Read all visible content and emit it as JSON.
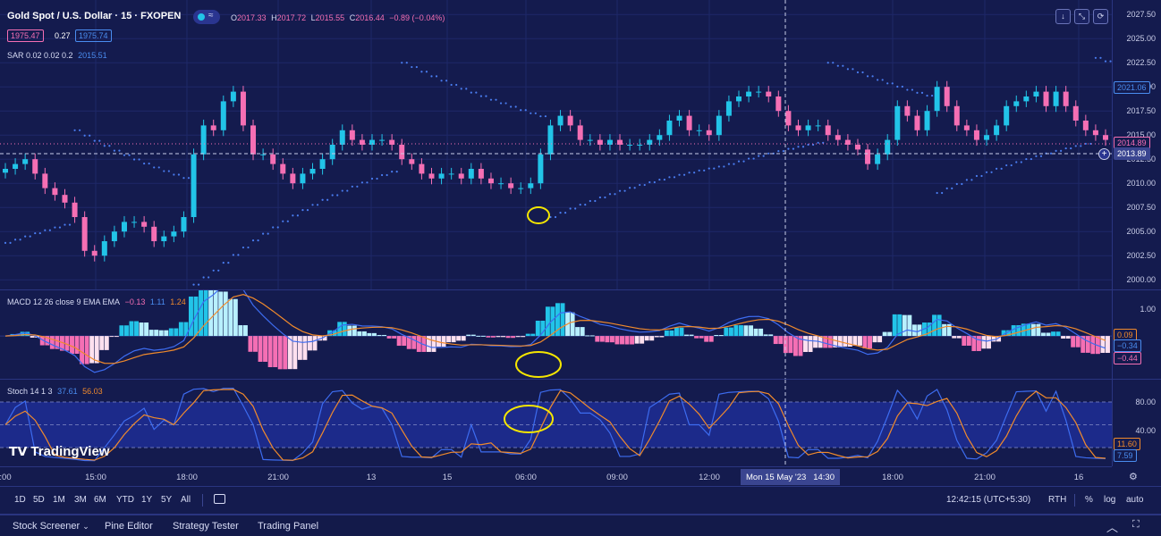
{
  "header": {
    "symbol": "Gold Spot / U.S. Dollar · 15 · FXOPEN",
    "o_label": "O",
    "o": "2017.33",
    "h_label": "H",
    "h": "2017.72",
    "l_label": "L",
    "l": "2015.55",
    "c_label": "C",
    "c": "2016.44",
    "change": "−0.89 (−0.04%)",
    "bid": "1975.47",
    "spread": "0.27",
    "ask": "1975.74",
    "sar_label": "SAR 0.02 0.02 0.2",
    "sar_value": "2015.51",
    "visibility_icon": "eye-toggle-icon",
    "buttons": {
      "down_icon": "arrow-down-icon",
      "collapse_icon": "collapse-icon",
      "refresh_icon": "refresh-icon"
    }
  },
  "price_axis": {
    "ticks": [
      "2027.50",
      "2025.00",
      "2022.50",
      "2020.00",
      "2017.50",
      "2015.00",
      "2012.50",
      "2010.00",
      "2007.50",
      "2005.00",
      "2002.50",
      "2000.00"
    ],
    "tag_blue": "2021.06",
    "tag_pink": "2014.89",
    "tag_crosshair": "2013.89"
  },
  "macd": {
    "label": "MACD 12 26 close 9 EMA EMA",
    "v1": "−0.13",
    "v2": "1.11",
    "v3": "1.24",
    "axis_tick": "1.00",
    "tag_orange": "0.09",
    "tag_blue": "−0.34",
    "tag_pink": "−0.44"
  },
  "stoch": {
    "label": "Stoch 14 1 3",
    "k": "37.61",
    "d": "56.03",
    "ticks": [
      "80.00",
      "40.00"
    ],
    "tag_orange": "11.60",
    "tag_blue": "7.59"
  },
  "watermark": "TradingView",
  "time_axis": {
    "labels": [
      ":00",
      "15:00",
      "18:00",
      "21:00",
      "13",
      "15",
      "06:00",
      "09:00",
      "12:00",
      "18:00",
      "21:00",
      "16"
    ],
    "crosshair_label": "Mon 15 May '23   14:30"
  },
  "bottom_bar": {
    "ranges": [
      "1D",
      "5D",
      "1M",
      "3M",
      "6M",
      "YTD",
      "1Y",
      "5Y",
      "All"
    ],
    "compare_icon": "calendar-goto-icon",
    "clock": "12:42:15 (UTC+5:30)",
    "rth": "RTH",
    "pct": "%",
    "log": "log",
    "auto": "auto"
  },
  "panel_tabs": [
    "Stock Screener",
    "Pine Editor",
    "Strategy Tester",
    "Trading Panel"
  ],
  "colors": {
    "up": "#22c4e8",
    "down": "#f56fb4",
    "bg": "#141b4e",
    "sar": "#4a7df0",
    "macd": "#3d6cf0",
    "signal": "#f08a2c",
    "stoch_k": "#3d6cf0",
    "stoch_d": "#f08a2c",
    "annotation": "#f5e600"
  },
  "chart_data": {
    "type": "candlestick",
    "series": [
      {
        "name": "price",
        "close": [
          2011.5,
          2012,
          2012.5,
          2011,
          2009.5,
          2008.8,
          2008,
          2006.5,
          2003,
          2002.5,
          2004,
          2005,
          2006,
          2006,
          2005.5,
          2004,
          2004.5,
          2005,
          2006.5,
          2013,
          2016,
          2015.5,
          2018.5,
          2019.5,
          2016,
          2013,
          2013,
          2012,
          2011,
          2010,
          2011,
          2011.5,
          2012.5,
          2014,
          2015.5,
          2014.5,
          2014,
          2014.5,
          2014.5,
          2014,
          2012.5,
          2012,
          2011,
          2010.5,
          2011,
          2011,
          2010.5,
          2011.5,
          2010.5,
          2010,
          2010,
          2009.5,
          2009.5,
          2010,
          2013,
          2016,
          2017,
          2016,
          2014.5,
          2014.5,
          2014,
          2014.5,
          2014,
          2014,
          2014,
          2014.5,
          2015,
          2016.5,
          2017,
          2015.5,
          2015.5,
          2015,
          2017,
          2018.5,
          2019,
          2019.5,
          2019.5,
          2019,
          2017.5,
          2016,
          2015.5,
          2016,
          2016,
          2015,
          2014.5,
          2014,
          2013.5,
          2012,
          2013,
          2014.5,
          2018,
          2017,
          2015.5,
          2017.5,
          2020,
          2018,
          2016,
          2015.5,
          2014.5,
          2015,
          2016,
          2018,
          2018.5,
          2019,
          2019.5,
          2018,
          2019.5,
          2018,
          2016.5,
          2015.5,
          2015,
          2014.5
        ]
      }
    ],
    "ylim": [
      1999,
      2029
    ],
    "sar_start": 2005,
    "macd_ylim": [
      -1.5,
      1.6
    ],
    "stoch_ylim": [
      0,
      100
    ]
  }
}
